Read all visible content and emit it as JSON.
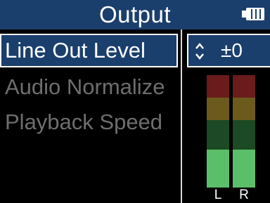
{
  "header": {
    "title": "Output",
    "battery_icon": "battery-full-icon"
  },
  "menu": {
    "items": [
      {
        "label": "Line Out Level",
        "selected": true
      },
      {
        "label": "Audio Normalize",
        "selected": false
      },
      {
        "label": "Playback Speed",
        "selected": false
      }
    ]
  },
  "value": {
    "icon": "up-down-arrows-icon",
    "text": "±0"
  },
  "meters": {
    "left_label": "L",
    "right_label": "R",
    "left_level": 0.34,
    "right_level": 0.34,
    "colors": {
      "red": "#6b1b1b",
      "yellow": "#6b5a1b",
      "dim_green": "#1b4a24",
      "active_green": "#5bbf6a"
    }
  },
  "colors": {
    "accent": "#1b3f6d",
    "background": "#000000",
    "dim_text": "#6e6e6e"
  }
}
